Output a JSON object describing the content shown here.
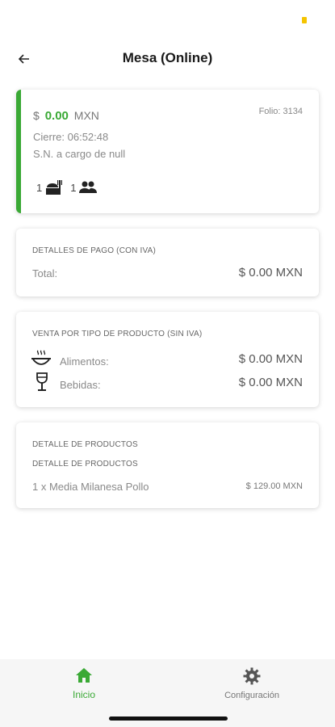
{
  "header": {
    "title": "Mesa (Online)"
  },
  "summary": {
    "currency_symbol": "$",
    "amount": "0.00",
    "currency_code": "MXN",
    "folio": "Folio: 3134",
    "close_time": "Cierre: 06:52:48",
    "service_note": "S.N. a cargo de null",
    "tables_count": "1",
    "people_count": "1"
  },
  "payment": {
    "title": "DETALLES DE PAGO (CON IVA)",
    "total_label": "Total:",
    "total_value": "$ 0.00 MXN"
  },
  "sales_by_type": {
    "title": "VENTA POR TIPO DE PRODUCTO (SIN IVA)",
    "items": [
      {
        "label": "Alimentos:",
        "value": "$ 0.00 MXN",
        "icon": "food-icon"
      },
      {
        "label": "Bebidas:",
        "value": "$ 0.00 MXN",
        "icon": "drink-icon"
      }
    ]
  },
  "products": {
    "title": "DETALLE DE PRODUCTOS",
    "subtitle": "DETALLE DE PRODUCTOS",
    "items": [
      {
        "label": "1 x Media Milanesa Pollo",
        "value": "$ 129.00 MXN"
      }
    ]
  },
  "nav": {
    "home_label": "Inicio",
    "settings_label": "Configuración"
  },
  "colors": {
    "accent": "#3aa935",
    "status_dot": "#f5c400"
  }
}
